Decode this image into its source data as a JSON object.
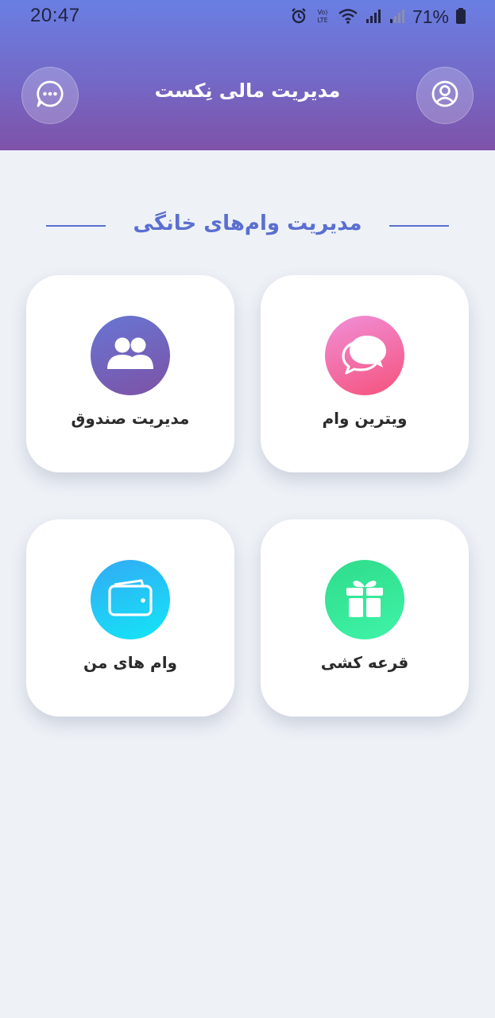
{
  "status_bar": {
    "time": "20:47",
    "battery_percent": "71%",
    "icons": [
      "alarm-icon",
      "volte-icon",
      "wifi-icon",
      "signal-icon",
      "signal-weak-icon",
      "battery-icon"
    ]
  },
  "header": {
    "title": "مدیریت مالی نِکست",
    "left_button_icon": "chat-icon",
    "right_button_icon": "user-icon"
  },
  "section": {
    "title": "مدیریت وام‌های خانگی"
  },
  "cards": {
    "fund": {
      "label": "مدیریت صندوق",
      "icon": "users-icon"
    },
    "showcase": {
      "label": "ویترین وام",
      "icon": "chat-bubbles-icon"
    },
    "my_loans": {
      "label": "وام های من",
      "icon": "wallet-icon"
    },
    "lottery": {
      "label": "قرعه کشی",
      "icon": "gift-icon"
    }
  },
  "colors": {
    "header_gradient_top": "#6a7fe3",
    "header_gradient_bottom": "#7e52a8",
    "accent": "#5a6fd0",
    "background": "#eef2f7"
  }
}
